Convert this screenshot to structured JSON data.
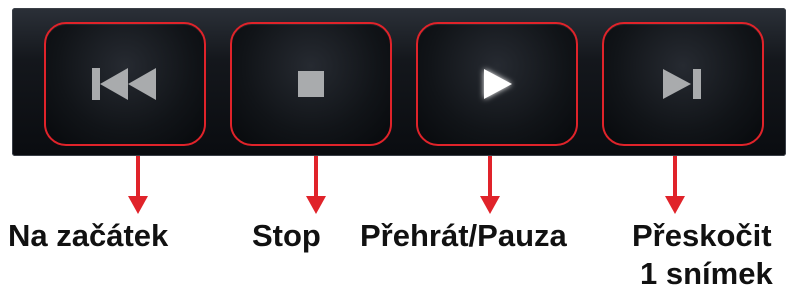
{
  "controls": [
    {
      "id": "start",
      "icon": "skip-to-start-icon",
      "label": "Na začátek"
    },
    {
      "id": "stop",
      "icon": "stop-icon",
      "label": "Stop"
    },
    {
      "id": "play",
      "icon": "play-icon",
      "label": "Přehrát/Pauza"
    },
    {
      "id": "step",
      "icon": "step-forward-icon",
      "label_line1": "Přeskočit",
      "label_line2": "1 snímek"
    }
  ],
  "colors": {
    "highlight": "#e0232a",
    "icon_gray": "#a9abad",
    "icon_active": "#ffffff",
    "toolbar_bg": "#0a0c10"
  }
}
